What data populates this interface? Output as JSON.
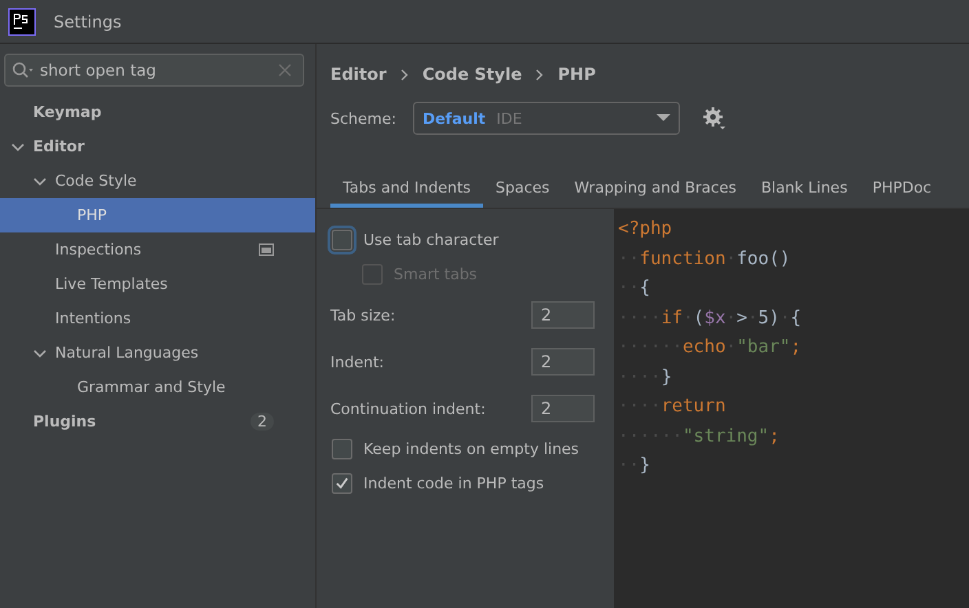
{
  "window": {
    "title": "Settings"
  },
  "search": {
    "value": "short open tag"
  },
  "sidebar": {
    "items": [
      {
        "label": "Keymap",
        "bold": true,
        "selected": false
      },
      {
        "label": "Editor",
        "bold": true,
        "selected": false,
        "expanded": true,
        "children": [
          {
            "label": "Code Style",
            "selected": false,
            "expanded": true,
            "children": [
              {
                "label": "PHP",
                "selected": true
              }
            ]
          },
          {
            "label": "Inspections",
            "selected": false,
            "project_badge": true
          },
          {
            "label": "Live Templates",
            "selected": false
          },
          {
            "label": "Intentions",
            "selected": false
          },
          {
            "label": "Natural Languages",
            "selected": false,
            "expanded": true,
            "children": [
              {
                "label": "Grammar and Style",
                "selected": false
              }
            ]
          }
        ]
      },
      {
        "label": "Plugins",
        "bold": true,
        "selected": false,
        "count": "2"
      }
    ]
  },
  "breadcrumb": [
    "Editor",
    "Code Style",
    "PHP"
  ],
  "scheme": {
    "label": "Scheme:",
    "name": "Default",
    "scope": "IDE"
  },
  "tabs": [
    {
      "label": "Tabs and Indents",
      "selected": true
    },
    {
      "label": "Spaces",
      "selected": false
    },
    {
      "label": "Wrapping and Braces",
      "selected": false
    },
    {
      "label": "Blank Lines",
      "selected": false
    },
    {
      "label": "PHPDoc",
      "selected": false
    }
  ],
  "options": [
    {
      "kind": "checkbox",
      "label": "Use tab character",
      "checked": false,
      "focused": true,
      "disabled": false,
      "nested": false
    },
    {
      "kind": "checkbox",
      "label": "Smart tabs",
      "checked": false,
      "focused": false,
      "disabled": true,
      "nested": true
    },
    {
      "kind": "number",
      "label": "Tab size:",
      "value": "2"
    },
    {
      "kind": "number",
      "label": "Indent:",
      "value": "2"
    },
    {
      "kind": "number",
      "label": "Continuation indent:",
      "value": "2"
    },
    {
      "kind": "checkbox",
      "label": "Keep indents on empty lines",
      "checked": false,
      "focused": false,
      "disabled": false,
      "nested": false
    },
    {
      "kind": "checkbox",
      "label": "Indent code in PHP tags",
      "checked": true,
      "focused": false,
      "disabled": false,
      "nested": false
    }
  ],
  "code_preview": {
    "lines": [
      [
        {
          "kind": "keyword",
          "text": "<?php"
        }
      ],
      [
        {
          "kind": "ws",
          "text": "··"
        },
        {
          "kind": "keyword",
          "text": "function"
        },
        {
          "kind": "ws",
          "text": "·"
        },
        {
          "kind": "plain",
          "text": "foo()"
        }
      ],
      [
        {
          "kind": "ws",
          "text": "··"
        },
        {
          "kind": "plain",
          "text": "{"
        }
      ],
      [
        {
          "kind": "ws",
          "text": "····"
        },
        {
          "kind": "keyword",
          "text": "if"
        },
        {
          "kind": "ws",
          "text": "·"
        },
        {
          "kind": "plain",
          "text": "("
        },
        {
          "kind": "variable",
          "text": "$x"
        },
        {
          "kind": "ws",
          "text": "·"
        },
        {
          "kind": "plain",
          "text": ">"
        },
        {
          "kind": "ws",
          "text": "·"
        },
        {
          "kind": "plain",
          "text": "5)"
        },
        {
          "kind": "ws",
          "text": "·"
        },
        {
          "kind": "plain",
          "text": "{"
        }
      ],
      [
        {
          "kind": "ws",
          "text": "······"
        },
        {
          "kind": "keyword",
          "text": "echo"
        },
        {
          "kind": "ws",
          "text": "·"
        },
        {
          "kind": "string",
          "text": "\"bar\""
        },
        {
          "kind": "keyword",
          "text": ";"
        }
      ],
      [
        {
          "kind": "ws",
          "text": "····"
        },
        {
          "kind": "plain",
          "text": "}"
        }
      ],
      [
        {
          "kind": "ws",
          "text": "····"
        },
        {
          "kind": "keyword",
          "text": "return"
        }
      ],
      [
        {
          "kind": "ws",
          "text": "······"
        },
        {
          "kind": "string",
          "text": "\"string\""
        },
        {
          "kind": "keyword",
          "text": ";"
        }
      ],
      [
        {
          "kind": "ws",
          "text": "··"
        },
        {
          "kind": "plain",
          "text": "}"
        }
      ]
    ]
  }
}
